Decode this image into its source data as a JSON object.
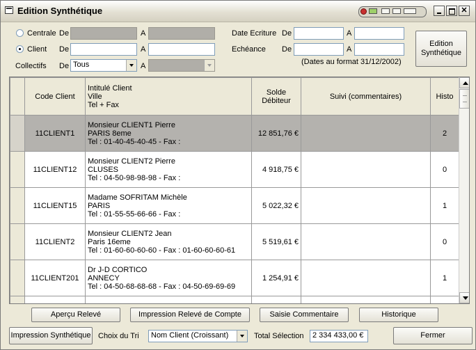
{
  "window": {
    "title": "Edition Synthétique"
  },
  "filters": {
    "centrale_label": "Centrale",
    "client_label": "Client",
    "collectifs_label": "Collectifs",
    "de_label": "De",
    "a_label": "A",
    "collectifs_value": "Tous",
    "date_ecriture_label": "Date Ecriture",
    "echeance_label": "Echéance",
    "date_hint": "(Dates au format 31/12/2002)",
    "edition_button": [
      "Edition",
      "Synthétique"
    ]
  },
  "table": {
    "headers": {
      "code": "Code Client",
      "intitule": [
        "Intitulé Client",
        "Ville",
        "Tel + Fax"
      ],
      "solde": [
        "Solde",
        "Débiteur"
      ],
      "suivi": "Suivi (commentaires)",
      "histo": "Histo"
    },
    "rows": [
      {
        "code": "11CLIENT1",
        "name": "Monsieur CLIENT1 Pierre",
        "city": "PARIS 8eme",
        "tel": "Tel : 01-40-45-40-45 - Fax :",
        "solde": "12 851,76 €",
        "suivi": "",
        "histo": "2"
      },
      {
        "code": "11CLIENT12",
        "name": "Monsieur CLIENT2 Pierre",
        "city": "CLUSES",
        "tel": "Tel : 04-50-98-98-98 - Fax :",
        "solde": "4 918,75 €",
        "suivi": "",
        "histo": "0"
      },
      {
        "code": "11CLIENT15",
        "name": "Madame SOFRITAM Michèle",
        "city": "PARIS",
        "tel": "Tel : 01-55-55-66-66 - Fax :",
        "solde": "5 022,32 €",
        "suivi": "",
        "histo": "1"
      },
      {
        "code": "11CLIENT2",
        "name": "Monsieur CLIENT2 Jean",
        "city": "Paris 16eme",
        "tel": "Tel : 01-60-60-60-60 - Fax : 01-60-60-60-61",
        "solde": "5 519,61 €",
        "suivi": "",
        "histo": "0"
      },
      {
        "code": "11CLIENT201",
        "name": "Dr J-D CORTICO",
        "city": "ANNECY",
        "tel": "Tel : 04-50-68-68-68 - Fax : 04-50-69-69-69",
        "solde": "1 254,91 €",
        "suivi": "",
        "histo": "1"
      }
    ]
  },
  "actions": {
    "apercu": "Aperçu Relevé",
    "impression_releve": "Impression Relevé de Compte",
    "saisie": "Saisie Commentaire",
    "historique": "Historique"
  },
  "footer": {
    "impression_synthetique": "Impression Synthétique",
    "choix_tri_label": "Choix du Tri",
    "tri_value": "Nom Client (Croissant)",
    "total_label": "Total Sélection",
    "total_value": "2 334 433,00 €",
    "fermer": "Fermer"
  },
  "selected_row": 0
}
